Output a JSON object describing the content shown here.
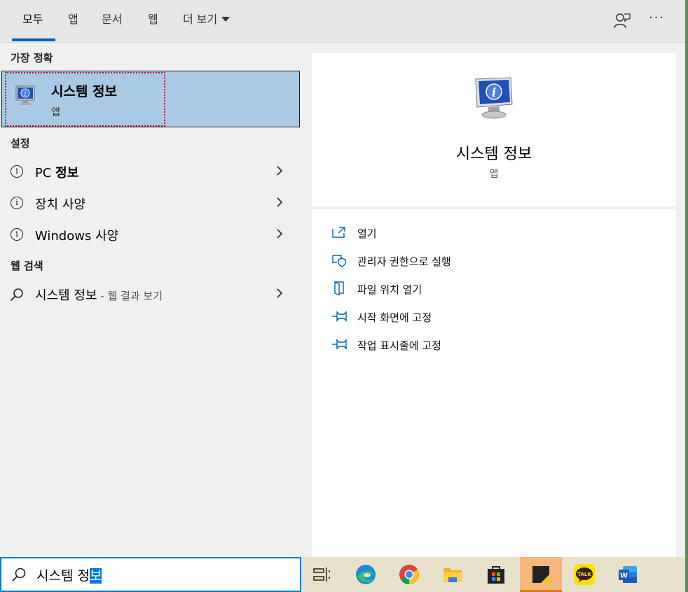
{
  "tabs": [
    {
      "label": "모두",
      "active": true
    },
    {
      "label": "앱"
    },
    {
      "label": "문서"
    },
    {
      "label": "웹"
    },
    {
      "label": "더 보기"
    }
  ],
  "toolbar": {
    "feedback_icon": "feedback-person-icon",
    "more_label": "···"
  },
  "left": {
    "best_match_header": "가장 정확",
    "best_match": {
      "title": "시스템 정보",
      "subtitle": "앱",
      "icon": "system-info-icon"
    },
    "settings_header": "설정",
    "settings": [
      {
        "label_plain": "PC ",
        "label_bold": "정보"
      },
      {
        "label_plain": "장치 사양",
        "label_bold": ""
      },
      {
        "label_plain": "Windows 사양",
        "label_bold": ""
      }
    ],
    "web_header": "웹 검색",
    "web": {
      "label": "시스템 정보",
      "suffix": " - 웹 결과 보기"
    }
  },
  "detail": {
    "title": "시스템 정보",
    "subtitle": "앱"
  },
  "actions": [
    {
      "label": "열기",
      "icon": "open-icon"
    },
    {
      "label": "관리자 권한으로 실행",
      "icon": "shield-icon"
    },
    {
      "label": "파일 위치 열기",
      "icon": "file-location-icon"
    },
    {
      "label": "시작 화면에 고정",
      "icon": "pin-icon"
    },
    {
      "label": "작업 표시줄에 고정",
      "icon": "pin-icon"
    }
  ],
  "search": {
    "value_unselected": "시스템 정",
    "value_selected": "보"
  },
  "taskbar": [
    {
      "name": "task-view"
    },
    {
      "name": "edge"
    },
    {
      "name": "chrome"
    },
    {
      "name": "file-explorer"
    },
    {
      "name": "microsoft-store"
    },
    {
      "name": "sticky-notes",
      "active": true
    },
    {
      "name": "kakaotalk",
      "label": "TALK"
    },
    {
      "name": "word",
      "label": "W"
    }
  ],
  "colors": {
    "accent": "#0078d7",
    "selection": "#a9c9e4",
    "taskbar": "#e8e2cc"
  }
}
